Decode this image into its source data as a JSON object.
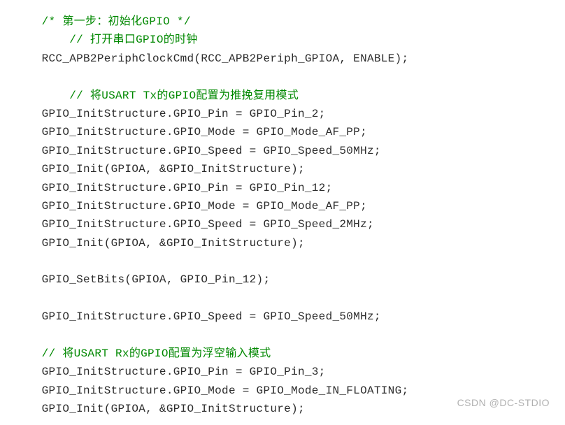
{
  "lines": [
    {
      "indent": 1,
      "segments": [
        {
          "t": "/* 第一步：初始化GPIO */",
          "c": "comment"
        }
      ]
    },
    {
      "indent": 2,
      "segments": [
        {
          "t": "// 打开串口GPIO的时钟",
          "c": "comment"
        }
      ]
    },
    {
      "indent": 1,
      "segments": [
        {
          "t": "RCC_APB2PeriphClockCmd(RCC_APB2Periph_GPIOA, ENABLE);",
          "c": ""
        }
      ]
    },
    {
      "indent": 0,
      "segments": [
        {
          "t": "",
          "c": ""
        }
      ]
    },
    {
      "indent": 2,
      "segments": [
        {
          "t": "// 将USART Tx的GPIO配置为推挽复用模式",
          "c": "comment"
        }
      ]
    },
    {
      "indent": 1,
      "segments": [
        {
          "t": "GPIO_InitStructure.GPIO_Pin = GPIO_Pin_2;",
          "c": ""
        }
      ]
    },
    {
      "indent": 1,
      "segments": [
        {
          "t": "GPIO_InitStructure.GPIO_Mode = GPIO_Mode_AF_PP;",
          "c": ""
        }
      ]
    },
    {
      "indent": 1,
      "segments": [
        {
          "t": "GPIO_InitStructure.GPIO_Speed = GPIO_Speed_50MHz;",
          "c": ""
        }
      ]
    },
    {
      "indent": 1,
      "segments": [
        {
          "t": "GPIO_Init(GPIOA, &GPIO_InitStructure);",
          "c": ""
        }
      ]
    },
    {
      "indent": 1,
      "segments": [
        {
          "t": "GPIO_InitStructure.GPIO_Pin = GPIO_Pin_12;",
          "c": ""
        }
      ]
    },
    {
      "indent": 1,
      "segments": [
        {
          "t": "GPIO_InitStructure.GPIO_Mode = GPIO_Mode_AF_PP;",
          "c": ""
        }
      ]
    },
    {
      "indent": 1,
      "segments": [
        {
          "t": "GPIO_InitStructure.GPIO_Speed = GPIO_Speed_2MHz;",
          "c": ""
        }
      ]
    },
    {
      "indent": 1,
      "segments": [
        {
          "t": "GPIO_Init(GPIOA, &GPIO_InitStructure);",
          "c": ""
        }
      ]
    },
    {
      "indent": 0,
      "segments": [
        {
          "t": "",
          "c": ""
        }
      ]
    },
    {
      "indent": 1,
      "segments": [
        {
          "t": "GPIO_SetBits(GPIOA, GPIO_Pin_12);",
          "c": ""
        }
      ]
    },
    {
      "indent": 0,
      "segments": [
        {
          "t": "",
          "c": ""
        }
      ]
    },
    {
      "indent": 1,
      "segments": [
        {
          "t": "GPIO_InitStructure.GPIO_Speed = GPIO_Speed_50MHz;",
          "c": ""
        }
      ]
    },
    {
      "indent": 0,
      "segments": [
        {
          "t": "",
          "c": ""
        }
      ]
    },
    {
      "indent": 1,
      "segments": [
        {
          "t": "// 将USART Rx的GPIO配置为浮空输入模式",
          "c": "comment"
        }
      ]
    },
    {
      "indent": 1,
      "segments": [
        {
          "t": "GPIO_InitStructure.GPIO_Pin = GPIO_Pin_3;",
          "c": ""
        }
      ]
    },
    {
      "indent": 1,
      "segments": [
        {
          "t": "GPIO_InitStructure.GPIO_Mode = GPIO_Mode_IN_FLOATING;",
          "c": ""
        }
      ]
    },
    {
      "indent": 1,
      "segments": [
        {
          "t": "GPIO_Init(GPIOA, &GPIO_InitStructure);",
          "c": ""
        }
      ]
    }
  ],
  "watermark": "CSDN @DC-STDIO"
}
